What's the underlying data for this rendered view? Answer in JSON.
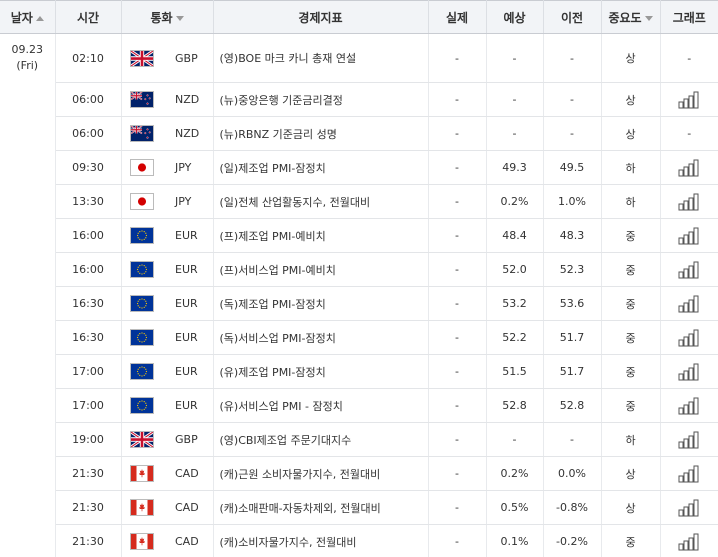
{
  "columns": {
    "date": "날자",
    "time": "시간",
    "currency": "통화",
    "indicator": "경제지표",
    "actual": "실제",
    "forecast": "예상",
    "previous": "이전",
    "importance": "중요도",
    "graph": "그래프"
  },
  "date": {
    "day": "09.23",
    "weekday": "(Fri)"
  },
  "graph_none": "-",
  "rows": [
    {
      "time": "02:10",
      "flag": "uk-flag-icon",
      "currency": "GBP",
      "indicator": "(영)BOE 마크 카니 총재 연설",
      "actual": "-",
      "forecast": "-",
      "previous": "-",
      "importance": "상",
      "graph": false
    },
    {
      "time": "06:00",
      "flag": "nz-flag-icon",
      "currency": "NZD",
      "indicator": "(뉴)중앙은행 기준금리결정",
      "actual": "-",
      "forecast": "-",
      "previous": "-",
      "importance": "상",
      "graph": true
    },
    {
      "time": "06:00",
      "flag": "nz-flag-icon",
      "currency": "NZD",
      "indicator": "(뉴)RBNZ 기준금리 성명",
      "actual": "-",
      "forecast": "-",
      "previous": "-",
      "importance": "상",
      "graph": false
    },
    {
      "time": "09:30",
      "flag": "jp-flag-icon",
      "currency": "JPY",
      "indicator": "(일)제조업 PMI-잠정치",
      "actual": "-",
      "forecast": "49.3",
      "previous": "49.5",
      "importance": "하",
      "graph": true
    },
    {
      "time": "13:30",
      "flag": "jp-flag-icon",
      "currency": "JPY",
      "indicator": "(일)전체 산업활동지수, 전월대비",
      "actual": "-",
      "forecast": "0.2%",
      "previous": "1.0%",
      "importance": "하",
      "graph": true
    },
    {
      "time": "16:00",
      "flag": "eu-flag-icon",
      "currency": "EUR",
      "indicator": "(프)제조업 PMI-예비치",
      "actual": "-",
      "forecast": "48.4",
      "previous": "48.3",
      "importance": "중",
      "graph": true
    },
    {
      "time": "16:00",
      "flag": "eu-flag-icon",
      "currency": "EUR",
      "indicator": "(프)서비스업 PMI-예비치",
      "actual": "-",
      "forecast": "52.0",
      "previous": "52.3",
      "importance": "중",
      "graph": true
    },
    {
      "time": "16:30",
      "flag": "eu-flag-icon",
      "currency": "EUR",
      "indicator": "(독)제조업 PMI-잠정치",
      "actual": "-",
      "forecast": "53.2",
      "previous": "53.6",
      "importance": "중",
      "graph": true
    },
    {
      "time": "16:30",
      "flag": "eu-flag-icon",
      "currency": "EUR",
      "indicator": "(독)서비스업 PMI-잠정치",
      "actual": "-",
      "forecast": "52.2",
      "previous": "51.7",
      "importance": "중",
      "graph": true
    },
    {
      "time": "17:00",
      "flag": "eu-flag-icon",
      "currency": "EUR",
      "indicator": "(유)제조업 PMI-잠정치",
      "actual": "-",
      "forecast": "51.5",
      "previous": "51.7",
      "importance": "중",
      "graph": true
    },
    {
      "time": "17:00",
      "flag": "eu-flag-icon",
      "currency": "EUR",
      "indicator": "(유)서비스업 PMI - 잠정치",
      "actual": "-",
      "forecast": "52.8",
      "previous": "52.8",
      "importance": "중",
      "graph": true
    },
    {
      "time": "19:00",
      "flag": "uk-flag-icon",
      "currency": "GBP",
      "indicator": "(영)CBI제조업 주문기대지수",
      "actual": "-",
      "forecast": "-",
      "previous": "-",
      "importance": "하",
      "graph": true
    },
    {
      "time": "21:30",
      "flag": "ca-flag-icon",
      "currency": "CAD",
      "indicator": "(캐)근원 소비자물가지수, 전월대비",
      "actual": "-",
      "forecast": "0.2%",
      "previous": "0.0%",
      "importance": "상",
      "graph": true
    },
    {
      "time": "21:30",
      "flag": "ca-flag-icon",
      "currency": "CAD",
      "indicator": "(캐)소매판매-자동차제외, 전월대비",
      "actual": "-",
      "forecast": "0.5%",
      "previous": "-0.8%",
      "importance": "상",
      "graph": true
    },
    {
      "time": "21:30",
      "flag": "ca-flag-icon",
      "currency": "CAD",
      "indicator": "(캐)소비자물가지수, 전월대비",
      "actual": "-",
      "forecast": "0.1%",
      "previous": "-0.2%",
      "importance": "중",
      "graph": true
    }
  ]
}
